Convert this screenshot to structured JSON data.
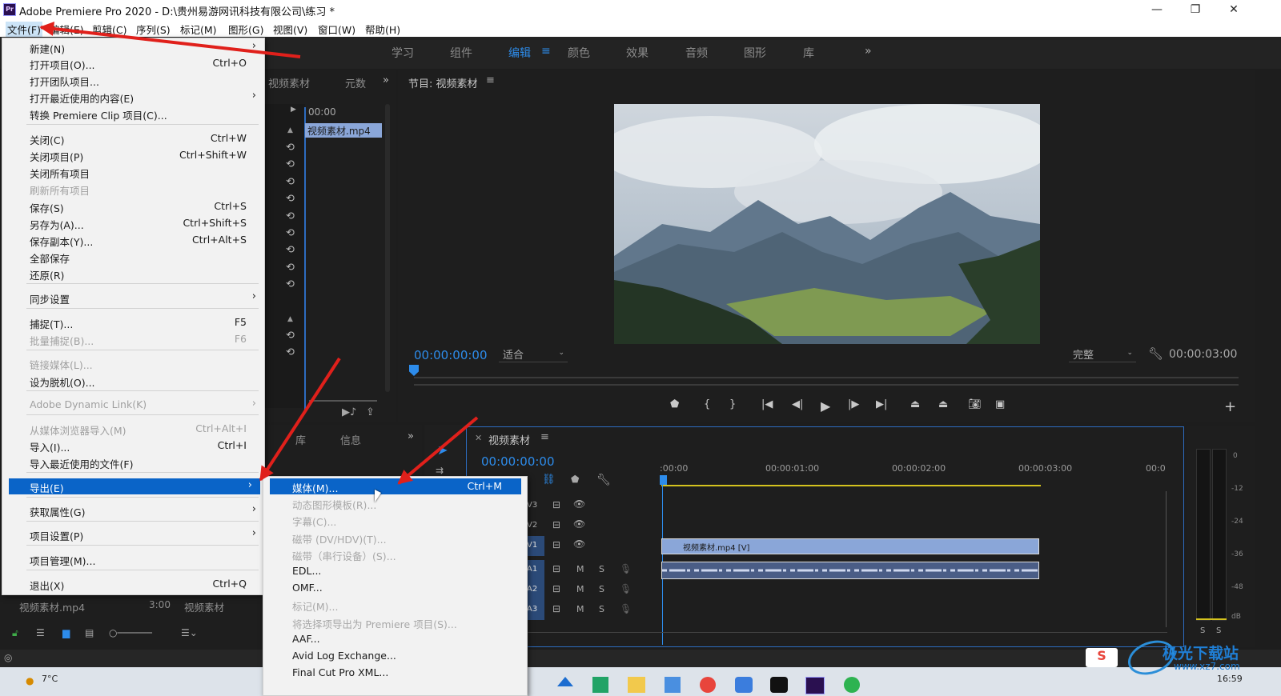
{
  "titlebar": {
    "title": "Adobe Premiere Pro 2020 - D:\\贵州易游网讯科技有限公司\\练习 *",
    "logo": "Pr",
    "minimize": "—",
    "maximize": "❐",
    "close": "✕"
  },
  "menubar": [
    "文件(F)",
    "编辑(E)",
    "剪辑(C)",
    "序列(S)",
    "标记(M)",
    "图形(G)",
    "视图(V)",
    "窗口(W)",
    "帮助(H)"
  ],
  "workspaces": [
    "学习",
    "组件",
    "编辑",
    "颜色",
    "效果",
    "音频",
    "图形",
    "库"
  ],
  "workspace_active": "编辑",
  "workspace_more": "»",
  "source_panel": {
    "tabs": [
      "视频素材",
      "元数"
    ],
    "timecode": "00:00",
    "clip": "视频素材.mp4"
  },
  "program_monitor": {
    "title": "节目: 视频素材",
    "timecode": "00:00:00:00",
    "fit": "适合",
    "quality": "完整",
    "duration": "00:00:03:00"
  },
  "project_panel": {
    "tabs": [
      "库",
      "信息"
    ],
    "clip_name": "视频素材.mp4",
    "clip_duration": "3:00",
    "clip_bin": "视频素材"
  },
  "timeline": {
    "title": "视频素材",
    "timecode": "00:00:00:00",
    "ruler": [
      ":00:00",
      "00:00:01:00",
      "00:00:02:00",
      "00:00:03:00",
      "00:0"
    ],
    "video_tracks": [
      "V3",
      "V2",
      "V1"
    ],
    "audio_tracks": [
      "A1",
      "A2",
      "A3"
    ],
    "video_clip": "视频素材.mp4 [V]",
    "mute": "M",
    "solo": "S"
  },
  "meter": {
    "labels": [
      "0",
      "-12",
      "-24",
      "-36",
      "-48",
      "dB"
    ],
    "solo": [
      "S",
      "S"
    ]
  },
  "file_menu": [
    {
      "label": "新建(N)",
      "shortcut": "",
      "submenu": true,
      "disabled": false
    },
    {
      "label": "打开项目(O)...",
      "shortcut": "Ctrl+O",
      "submenu": false,
      "disabled": false
    },
    {
      "label": "打开团队项目...",
      "shortcut": "",
      "submenu": false,
      "disabled": false
    },
    {
      "label": "打开最近使用的内容(E)",
      "shortcut": "",
      "submenu": true,
      "disabled": false
    },
    {
      "label": "转换 Premiere Clip 项目(C)...",
      "shortcut": "",
      "submenu": false,
      "disabled": false
    },
    {
      "label": "关闭(C)",
      "shortcut": "Ctrl+W",
      "submenu": false,
      "disabled": false
    },
    {
      "label": "关闭项目(P)",
      "shortcut": "Ctrl+Shift+W",
      "submenu": false,
      "disabled": false
    },
    {
      "label": "关闭所有项目",
      "shortcut": "",
      "submenu": false,
      "disabled": false
    },
    {
      "label": "刷新所有项目",
      "shortcut": "",
      "submenu": false,
      "disabled": true
    },
    {
      "label": "保存(S)",
      "shortcut": "Ctrl+S",
      "submenu": false,
      "disabled": false
    },
    {
      "label": "另存为(A)...",
      "shortcut": "Ctrl+Shift+S",
      "submenu": false,
      "disabled": false
    },
    {
      "label": "保存副本(Y)...",
      "shortcut": "Ctrl+Alt+S",
      "submenu": false,
      "disabled": false
    },
    {
      "label": "全部保存",
      "shortcut": "",
      "submenu": false,
      "disabled": false
    },
    {
      "label": "还原(R)",
      "shortcut": "",
      "submenu": false,
      "disabled": false
    },
    {
      "label": "同步设置",
      "shortcut": "",
      "submenu": true,
      "disabled": false
    },
    {
      "label": "捕捉(T)...",
      "shortcut": "F5",
      "submenu": false,
      "disabled": false
    },
    {
      "label": "批量捕捉(B)...",
      "shortcut": "F6",
      "submenu": false,
      "disabled": true
    },
    {
      "label": "链接媒体(L)...",
      "shortcut": "",
      "submenu": false,
      "disabled": true
    },
    {
      "label": "设为脱机(O)...",
      "shortcut": "",
      "submenu": false,
      "disabled": false
    },
    {
      "label": "Adobe Dynamic Link(K)",
      "shortcut": "",
      "submenu": true,
      "disabled": true
    },
    {
      "label": "从媒体浏览器导入(M)",
      "shortcut": "Ctrl+Alt+I",
      "submenu": false,
      "disabled": true
    },
    {
      "label": "导入(I)...",
      "shortcut": "Ctrl+I",
      "submenu": false,
      "disabled": false
    },
    {
      "label": "导入最近使用的文件(F)",
      "shortcut": "",
      "submenu": false,
      "disabled": false
    },
    {
      "label": "导出(E)",
      "shortcut": "",
      "submenu": true,
      "disabled": false,
      "highlighted": true
    },
    {
      "label": "获取属性(G)",
      "shortcut": "",
      "submenu": true,
      "disabled": false
    },
    {
      "label": "项目设置(P)",
      "shortcut": "",
      "submenu": true,
      "disabled": false
    },
    {
      "label": "项目管理(M)...",
      "shortcut": "",
      "submenu": false,
      "disabled": false
    },
    {
      "label": "退出(X)",
      "shortcut": "Ctrl+Q",
      "submenu": false,
      "disabled": false
    }
  ],
  "export_menu": [
    {
      "label": "媒体(M)...",
      "shortcut": "Ctrl+M",
      "disabled": false,
      "highlighted": true
    },
    {
      "label": "动态图形模板(R)...",
      "shortcut": "",
      "disabled": true
    },
    {
      "label": "字幕(C)...",
      "shortcut": "",
      "disabled": true
    },
    {
      "label": "磁带 (DV/HDV)(T)...",
      "shortcut": "",
      "disabled": true
    },
    {
      "label": "磁带（串行设备）(S)...",
      "shortcut": "",
      "disabled": true
    },
    {
      "label": "EDL...",
      "shortcut": "",
      "disabled": false
    },
    {
      "label": "OMF...",
      "shortcut": "",
      "disabled": false
    },
    {
      "label": "标记(M)...",
      "shortcut": "",
      "disabled": true
    },
    {
      "label": "将选择项导出为 Premiere 项目(S)...",
      "shortcut": "",
      "disabled": true
    },
    {
      "label": "AAF...",
      "shortcut": "",
      "disabled": false
    },
    {
      "label": "Avid Log Exchange...",
      "shortcut": "",
      "disabled": false
    },
    {
      "label": "Final Cut Pro XML...",
      "shortcut": "",
      "disabled": false
    }
  ],
  "taskbar": {
    "weather": "7°C",
    "time": "16:59"
  },
  "watermark": {
    "site": "极光下载站",
    "url": "www.xz7.com"
  },
  "colors": {
    "accent": "#0a64c8",
    "timecode": "#2d8ceb",
    "annotation_arrow": "#e0201b",
    "clip_video": "#8aa6d8",
    "timeline_work_area": "#d4c21e"
  }
}
